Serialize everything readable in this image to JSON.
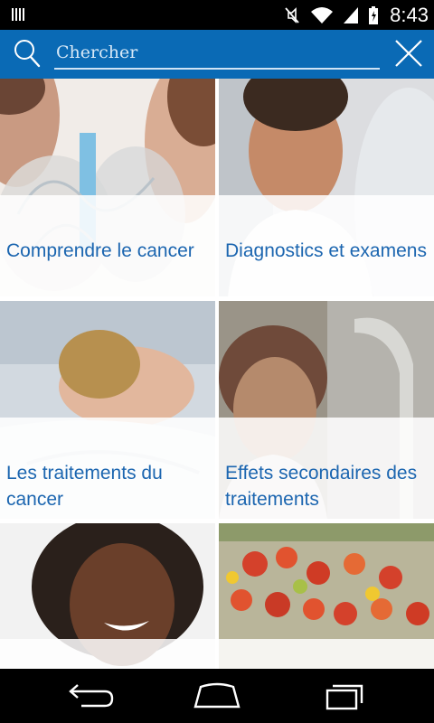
{
  "status_bar": {
    "time": "8:43",
    "icons": [
      "signal-bars-icon",
      "mute-icon",
      "wifi-icon",
      "cell-signal-icon",
      "battery-icon"
    ]
  },
  "search": {
    "placeholder": "Chercher",
    "value": "",
    "icon": "search-icon",
    "close_icon": "close-icon",
    "accent_color": "#0a6ab5"
  },
  "tiles": [
    {
      "title": "Comprendre le cancer",
      "image": "medical-model-photo"
    },
    {
      "title": "Diagnostics et examens",
      "image": "doctor-photo"
    },
    {
      "title": "Les traitements du cancer",
      "image": "patient-lying-photo"
    },
    {
      "title": "Effets secondaires des traitements",
      "image": "patient-headscarf-photo"
    },
    {
      "title": "",
      "image": "smiling-woman-photo"
    },
    {
      "title": "",
      "image": "vegetables-photo"
    }
  ],
  "caption_color": "#1c66b0",
  "nav_bar": {
    "icons": [
      "back-icon",
      "home-icon",
      "recent-apps-icon"
    ]
  }
}
